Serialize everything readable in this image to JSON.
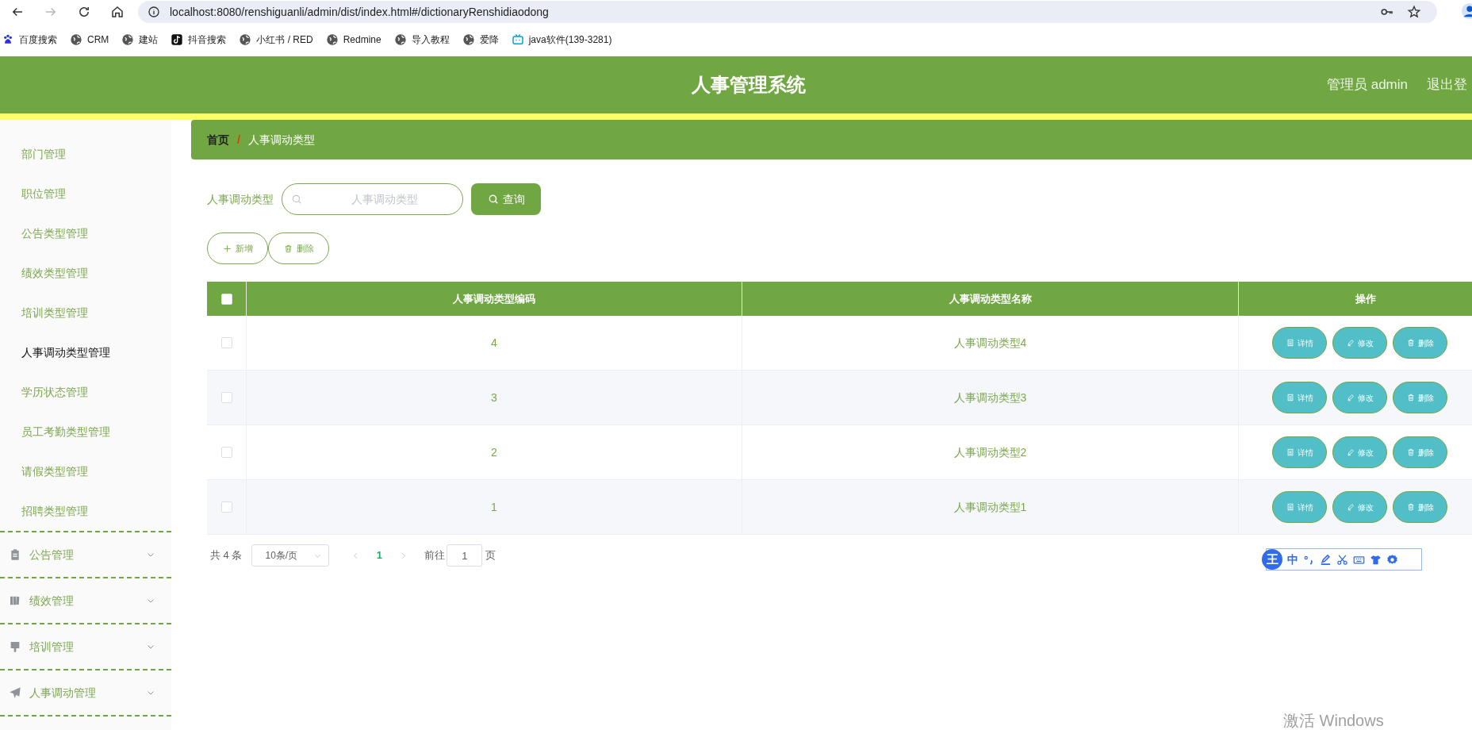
{
  "browser": {
    "url": "localhost:8080/renshiguanli/admin/dist/index.html#/dictionaryRenshidiaodong",
    "nav": [
      {
        "kind": "back",
        "disabled": false
      },
      {
        "kind": "forward",
        "disabled": true
      },
      {
        "kind": "reload",
        "disabled": false
      },
      {
        "kind": "home",
        "disabled": false
      }
    ],
    "bookmarks": [
      {
        "kind": "paw",
        "label": "百度搜索"
      },
      {
        "kind": "globe",
        "label": "CRM"
      },
      {
        "kind": "globe",
        "label": "建站"
      },
      {
        "kind": "note",
        "label": "抖音搜索"
      },
      {
        "kind": "globe",
        "label": "小红书 / RED"
      },
      {
        "kind": "globe",
        "label": "Redmine"
      },
      {
        "kind": "globe",
        "label": "导入教程"
      },
      {
        "kind": "globe",
        "label": "爱降"
      },
      {
        "kind": "tv",
        "label": "java软件(139-3281)"
      }
    ]
  },
  "header": {
    "title": "人事管理系统",
    "user": "管理员 admin",
    "logout": "退出登"
  },
  "sidebar": {
    "items": [
      {
        "label": "部门管理",
        "selected": false
      },
      {
        "label": "职位管理",
        "selected": false
      },
      {
        "label": "公告类型管理",
        "selected": false
      },
      {
        "label": "绩效类型管理",
        "selected": false
      },
      {
        "label": "培训类型管理",
        "selected": false
      },
      {
        "label": "人事调动类型管理",
        "selected": true
      },
      {
        "label": "学历状态管理",
        "selected": false
      },
      {
        "label": "员工考勤类型管理",
        "selected": false
      },
      {
        "label": "请假类型管理",
        "selected": false
      },
      {
        "label": "招聘类型管理",
        "selected": false
      }
    ],
    "groups": [
      {
        "kind": "clipboard",
        "label": "公告管理",
        "expanded": false
      },
      {
        "kind": "chart",
        "label": "绩效管理",
        "expanded": false
      },
      {
        "kind": "brush",
        "label": "培训管理",
        "expanded": false
      },
      {
        "kind": "plane",
        "label": "人事调动管理",
        "expanded": false
      }
    ]
  },
  "breadcrumb": {
    "items": [
      "首页",
      "人事调动类型"
    ],
    "separator": "/"
  },
  "search": {
    "label": "人事调动类型",
    "placeholder": "人事调动类型",
    "button": "查询"
  },
  "toolbar": {
    "add": "新增",
    "delete": "删除"
  },
  "table": {
    "columns": [
      "人事调动类型编码",
      "人事调动类型名称",
      "操作"
    ],
    "all_checked": false,
    "rows": [
      {
        "code": "4",
        "name": "人事调动类型4",
        "checked": false,
        "actions": [
          {
            "kind": "detail",
            "label": "详情"
          },
          {
            "kind": "edit",
            "label": "修改"
          },
          {
            "kind": "delete",
            "label": "删除"
          }
        ]
      },
      {
        "code": "3",
        "name": "人事调动类型3",
        "checked": false,
        "actions": [
          {
            "kind": "detail",
            "label": "详情"
          },
          {
            "kind": "edit",
            "label": "修改"
          },
          {
            "kind": "delete",
            "label": "删除"
          }
        ]
      },
      {
        "code": "2",
        "name": "人事调动类型2",
        "checked": false,
        "actions": [
          {
            "kind": "detail",
            "label": "详情"
          },
          {
            "kind": "edit",
            "label": "修改"
          },
          {
            "kind": "delete",
            "label": "删除"
          }
        ]
      },
      {
        "code": "1",
        "name": "人事调动类型1",
        "checked": false,
        "actions": [
          {
            "kind": "detail",
            "label": "详情"
          },
          {
            "kind": "edit",
            "label": "修改"
          },
          {
            "kind": "delete",
            "label": "删除"
          }
        ]
      }
    ]
  },
  "pagination": {
    "total": "共 4 条",
    "page_size": "10条/页",
    "pages": [
      {
        "label": "1",
        "selected": true
      }
    ],
    "goto_label": "前往",
    "goto_value": "1",
    "goto_suffix": "页"
  },
  "ime_toolbar": {
    "logo": "王",
    "mode": "中"
  },
  "os_notice": "激活 Windows"
}
